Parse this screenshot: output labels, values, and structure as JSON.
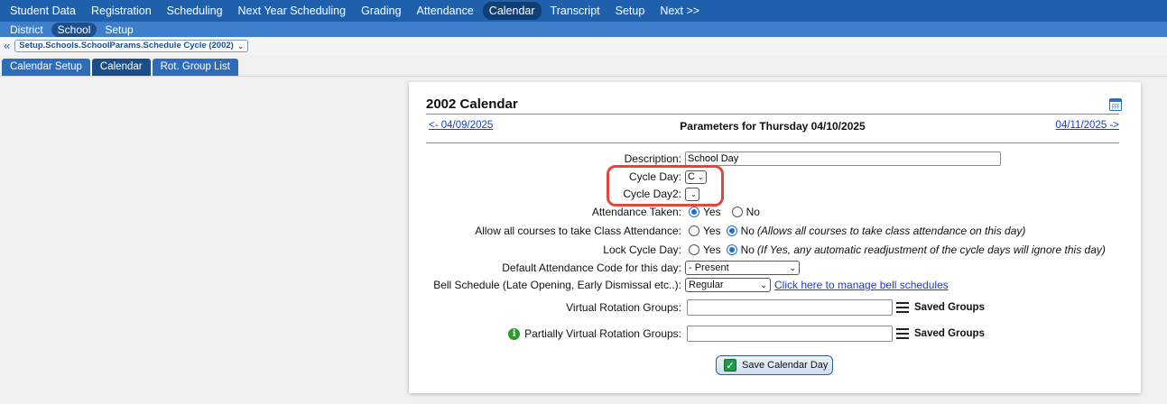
{
  "topnav": {
    "items": [
      {
        "label": "Student Data"
      },
      {
        "label": "Registration"
      },
      {
        "label": "Scheduling"
      },
      {
        "label": "Next Year Scheduling"
      },
      {
        "label": "Grading"
      },
      {
        "label": "Attendance"
      },
      {
        "label": "Calendar"
      },
      {
        "label": "Transcript"
      },
      {
        "label": "Setup"
      },
      {
        "label": "Next >>"
      }
    ],
    "active_index": 6
  },
  "subnav": {
    "items": [
      {
        "label": "District"
      },
      {
        "label": "School"
      },
      {
        "label": "Setup"
      }
    ],
    "active_index": 1
  },
  "breadcrumb": {
    "back_glyph": "«",
    "selected": "Setup.Schools.SchoolParams.Schedule Cycle (2002)"
  },
  "tabs": [
    {
      "label": "Calendar Setup"
    },
    {
      "label": "Calendar"
    },
    {
      "label": "Rot. Group List"
    }
  ],
  "panel": {
    "title": "2002 Calendar",
    "prev_day": "<- 04/09/2025",
    "next_day": "04/11/2025 ->",
    "heading": "Parameters for Thursday 04/10/2025",
    "description": {
      "label": "Description:",
      "value": "School Day"
    },
    "cycle_day": {
      "label": "Cycle Day:",
      "value": "C"
    },
    "cycle_day2": {
      "label": "Cycle Day2:",
      "value": ""
    },
    "attendance_taken": {
      "label": "Attendance Taken:",
      "yes": "Yes",
      "no": "No",
      "selected": "Yes"
    },
    "allow_all_courses": {
      "label": "Allow all courses to take Class Attendance:",
      "yes": "Yes",
      "no": "No",
      "selected": "No",
      "note": "(Allows all courses to take class attendance on this day)"
    },
    "lock_cycle_day": {
      "label": "Lock Cycle Day:",
      "yes": "Yes",
      "no": "No",
      "selected": "No",
      "note": "(If Yes, any automatic readjustment of the cycle days will ignore this day)"
    },
    "default_attendance_code": {
      "label": "Default Attendance Code for this day:",
      "value": "- Present"
    },
    "bell_schedule": {
      "label": "Bell Schedule (Late Opening, Early Dismissal etc..):",
      "value": "Regular",
      "link": "Click here to manage bell schedules"
    },
    "virtual_rotation": {
      "label": "Virtual Rotation Groups:",
      "value": "",
      "saved": "Saved Groups"
    },
    "partially_virtual": {
      "label": "Partially Virtual Rotation Groups:",
      "value": "",
      "saved": "Saved Groups"
    },
    "save_button": "Save Calendar Day"
  },
  "colors": {
    "topnav_bg": "#1f60ac",
    "subnav_bg": "#3e7fcc",
    "highlight": "#e0483b",
    "link": "#1a3fc4"
  }
}
